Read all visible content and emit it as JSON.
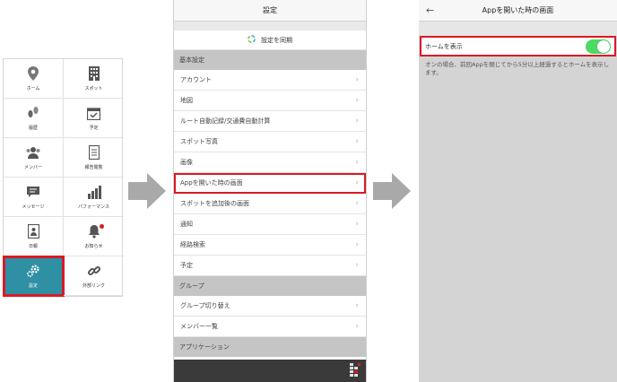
{
  "menu": {
    "items": [
      {
        "label": "ホーム",
        "icon": "map-pin-icon"
      },
      {
        "label": "スポット",
        "icon": "building-icon"
      },
      {
        "label": "履歴",
        "icon": "footprints-icon"
      },
      {
        "label": "予定",
        "icon": "calendar-check-icon"
      },
      {
        "label": "メンバー",
        "icon": "people-icon"
      },
      {
        "label": "報告閲覧",
        "icon": "document-icon"
      },
      {
        "label": "メッセージ",
        "icon": "chat-icon"
      },
      {
        "label": "パフォーマンス",
        "icon": "bar-chart-icon"
      },
      {
        "label": "日報",
        "icon": "report-icon"
      },
      {
        "label": "お知らせ",
        "icon": "bell-icon"
      },
      {
        "label": "設定",
        "icon": "gears-icon"
      },
      {
        "label": "外部リンク",
        "icon": "link-icon"
      }
    ],
    "active_color": "#2f8fa3",
    "highlight_color": "#d81b25"
  },
  "settings": {
    "title": "設定",
    "sync_label": "設定を同期",
    "section_basic": "基本設定",
    "basic_rows": [
      "アカウント",
      "地図",
      "ルート自動記録/交通費自動計算",
      "スポット写真",
      "画像",
      "Appを開いた時の画面",
      "スポットを追加後の画面",
      "通知",
      "経路検索",
      "予定"
    ],
    "section_group": "グループ",
    "group_rows": [
      "グループ切り替え",
      "メンバー一覧"
    ],
    "section_app": "アプリケーション",
    "chevron": "›"
  },
  "home_screen": {
    "title": "Appを開いた時の画面",
    "back_glyph": "←",
    "toggle_label": "ホームを表示",
    "toggle_on": true,
    "toggle_color": "#4cd964",
    "description": "オンの場合、前回Appを閉じてから5分以上経過するとホームを表示します。"
  }
}
